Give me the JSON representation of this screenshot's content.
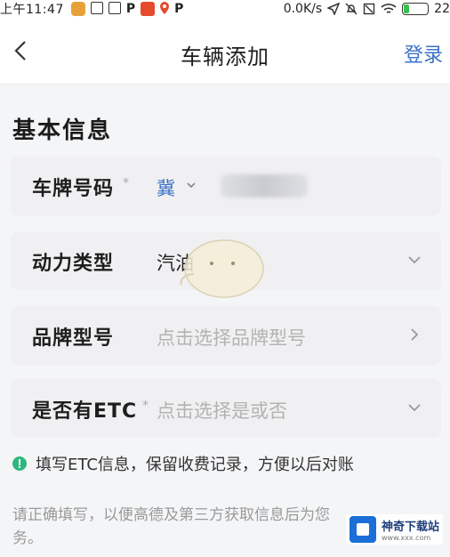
{
  "status_bar": {
    "time": "上午11:47",
    "speed": "0.0K/s",
    "battery": "22",
    "battery_level": 0.22
  },
  "nav": {
    "title": "车辆添加",
    "login": "登录",
    "back_icon": "chevron-left-icon"
  },
  "section": {
    "title": "基本信息"
  },
  "form": {
    "plate": {
      "label": "车牌号码",
      "required": "*",
      "province": "冀",
      "blurred": true
    },
    "power": {
      "label": "动力类型",
      "value": "汽油"
    },
    "brand": {
      "label": "品牌型号",
      "placeholder": "点击选择品牌型号"
    },
    "etc": {
      "label": "是否有ETC",
      "required": "*",
      "placeholder": "点击选择是或否"
    }
  },
  "tip": {
    "text": "填写ETC信息，保留收费记录，方便以后对账"
  },
  "notice": {
    "text": "请正确填写，以便高德及第三方获取信息后为您务。"
  },
  "watermark": {
    "name": "神奇下载站",
    "url": "www.xxx.com"
  },
  "colors": {
    "accent": "#3b72c8",
    "tip_icon": "#2eb67d",
    "battery_fill": "#35c24d"
  }
}
